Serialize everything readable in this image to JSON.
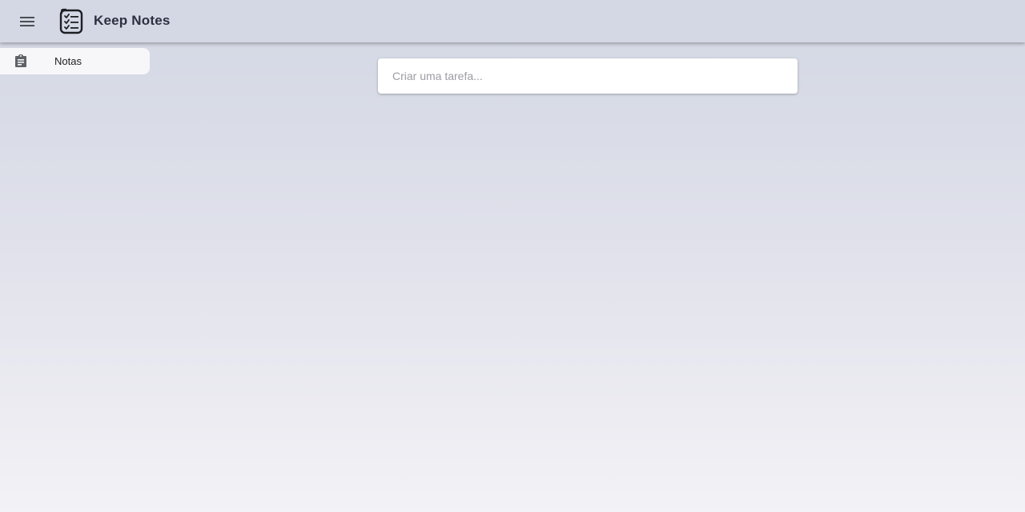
{
  "header": {
    "menu_icon": "menu-icon",
    "logo_icon": "checklist-clipboard-icon",
    "title": "Keep Notes"
  },
  "sidebar": {
    "items": [
      {
        "label": "Notas",
        "icon": "clipboard-icon",
        "active": true
      }
    ]
  },
  "main": {
    "task_input": {
      "placeholder": "Criar uma tarefa...",
      "value": ""
    }
  },
  "colors": {
    "topbar": "#d3d8e4",
    "background_top": "#d3d8e4",
    "background_bottom": "#f3f2f6",
    "sidebar_active": "#f7f6f9",
    "title_text": "#2d3040"
  }
}
